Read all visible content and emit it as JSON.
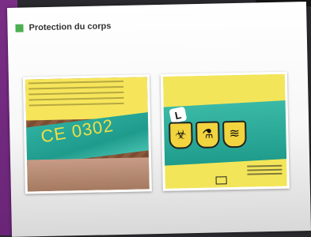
{
  "section": {
    "title": "Protection du corps",
    "accent_color": "#4caf50"
  },
  "photos": [
    {
      "name": "ce-marking-photo",
      "text": "CE 0302"
    },
    {
      "name": "hazard-pictograms-photo",
      "size_label": "L",
      "icons": [
        "biohazard-icon",
        "flask-icon",
        "water-icon"
      ]
    }
  ]
}
